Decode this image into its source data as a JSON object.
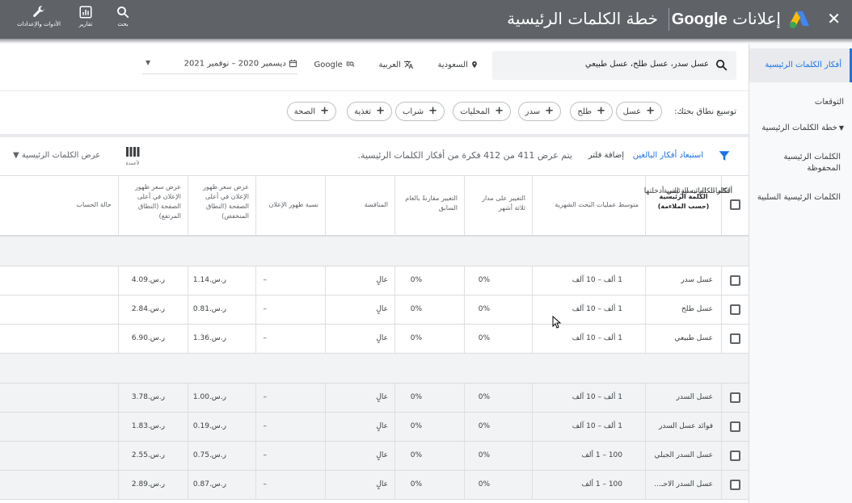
{
  "topbar": {
    "brand_text": "إعلانات",
    "brand_google": "Google",
    "title": "خطة الكلمات الرئيسية",
    "close_glyph": "✕",
    "tools": [
      {
        "label": "بحث",
        "icon": "search-icon"
      },
      {
        "label": "تقارير",
        "icon": "reports-icon"
      },
      {
        "label": "الأدوات والإعدادات",
        "icon": "wrench-icon"
      }
    ],
    "colors": {
      "bar": "#5f6368",
      "accent": "#1a73e8"
    }
  },
  "nav": {
    "items": [
      {
        "label": "أفكار الكلمات الرئيسية",
        "active": true
      },
      {
        "label": "التوقعات"
      },
      {
        "label": "خطة الكلمات الرئيسية",
        "caret": "▼"
      },
      {
        "label": "الكلمات الرئيسية المحفوظة"
      },
      {
        "label": "الكلمات الرئيسية السلبية"
      }
    ]
  },
  "search": {
    "query": "عسل سدر، عسل طلح، عسل طبيعي",
    "location": "السعودية",
    "language": "العربية",
    "network": "Google",
    "date_range": "ديسمبر 2020 – نوفمبر 2021",
    "date_caret": "▼"
  },
  "expand": {
    "label": "توسيع نطاق بحثك:",
    "chips": [
      "عسل",
      "طلح",
      "سدر",
      "المحليات",
      "شراب",
      "تغذية",
      "الصحة"
    ]
  },
  "filter_bar": {
    "exclude_link": "استبعاد أفكار البالغين",
    "add_filter": "إضافة فلتر",
    "count_text": "يتم عرض 411 من 412 فكرة من أفكار الكلمات الرئيسية.",
    "columns_label": "لأعمدة",
    "view_label": "عرض الكلمات الرئيسية",
    "view_caret": "▼"
  },
  "table": {
    "headers": {
      "keyword": "الكلمة الرئيسية (حسب الملاءمة)",
      "avg_searches": "متوسط عمليات البحث الشهرية",
      "three_month": "التغيير على مدار ثلاثة أشهر",
      "yoy": "التغيير مقارنةً بالعام السابق",
      "competition": "المنافسة",
      "impression_share": "نسبة ظهور الإعلان",
      "bid_low": "عرض سعر ظهور الإعلان في أعلى الصفحة (النطاق المنخفض)",
      "bid_high": "عرض سعر ظهور الإعلان في أعلى الصفحة (النطاق المرتفع)",
      "account_status": "حالة الحساب"
    },
    "sections": [
      {
        "title": "الكلمات الرئيسية التي أدخلتها",
        "rows": [
          {
            "keyword": "عسل سدر",
            "avg": "1 ألف – 10 آلف",
            "three_month": "0%",
            "yoy": "0%",
            "competition": "عالٍ",
            "share": "–",
            "low": "ر.س.1.14",
            "high": "ر.س.4.09"
          },
          {
            "keyword": "عسل طلح",
            "avg": "1 ألف – 10 آلف",
            "three_month": "0%",
            "yoy": "0%",
            "competition": "عالٍ",
            "share": "–",
            "low": "ر.س.0.81",
            "high": "ر.س.2.84"
          },
          {
            "keyword": "عسل طبيعي",
            "avg": "1 ألف – 10 آلف",
            "three_month": "0%",
            "yoy": "0%",
            "competition": "عالٍ",
            "share": "–",
            "low": "ر.س.1.36",
            "high": "ر.س.6.90"
          }
        ]
      },
      {
        "title": "أفكار الكلمات الرئيسية",
        "rows": [
          {
            "keyword": "عسل السدر",
            "avg": "1 ألف – 10 آلف",
            "three_month": "0%",
            "yoy": "0%",
            "competition": "عالٍ",
            "share": "–",
            "low": "ر.س.1.00",
            "high": "ر.س.3.78"
          },
          {
            "keyword": "فوائد عسل السدر",
            "avg": "1 ألف – 10 آلف",
            "three_month": "0%",
            "yoy": "0%",
            "competition": "عالٍ",
            "share": "–",
            "low": "ر.س.0.19",
            "high": "ر.س.1.83"
          },
          {
            "keyword": "عسل السدر الجبلي",
            "avg": "100 – 1 ألف",
            "three_month": "0%",
            "yoy": "0%",
            "competition": "عالٍ",
            "share": "–",
            "low": "ر.س.0.75",
            "high": "ر.س.2.55"
          },
          {
            "keyword": "عسل السدر الاحـ...",
            "avg": "100 – 1 ألف",
            "three_month": "0%",
            "yoy": "0%",
            "competition": "عالٍ",
            "share": "–",
            "low": "ر.س.0.87",
            "high": "ر.س.2.89"
          }
        ]
      }
    ]
  }
}
